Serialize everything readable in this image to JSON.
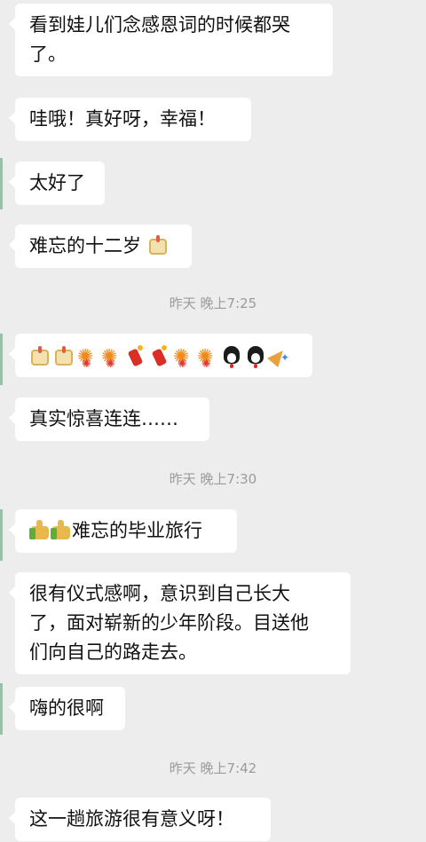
{
  "messages": [
    {
      "id": "m1",
      "text": "看到娃儿们念感恩词的时候都哭了。",
      "line1": "看到娃儿们念感恩词的时候都哭",
      "line2": "了。"
    },
    {
      "id": "m2",
      "text": "哇哦！真好呀，幸福！"
    },
    {
      "id": "m3",
      "text": "太好了"
    },
    {
      "id": "m4",
      "text": "难忘的十二岁"
    },
    {
      "id": "m6",
      "text": "真实惊喜连连……"
    },
    {
      "id": "m7",
      "text": "难忘的毕业旅行"
    },
    {
      "id": "m8",
      "line1": "很有仪式感啊，意识到自己长大",
      "line2": "了，面对崭新的少年阶段。目送他",
      "line3": "们向自己的路走去。"
    },
    {
      "id": "m9",
      "text": "嗨的很啊"
    },
    {
      "id": "m10",
      "text": "这一趟旅游很有意义呀！"
    }
  ],
  "timestamps": [
    "昨天 晚上7:25",
    "昨天 晚上7:30",
    "昨天 晚上7:42"
  ],
  "emoji_message": [
    "cake-icon",
    "cake-icon",
    "fireworks-icon",
    "fireworks-icon",
    "firecracker-icon",
    "firecracker-icon",
    "fireworks-icon",
    "fireworks-icon",
    "penguin-icon",
    "penguin-icon",
    "party-popper-icon"
  ],
  "colors": {
    "background": "#ededed",
    "bubble": "#ffffff",
    "timestamp": "#9b9b9b"
  }
}
